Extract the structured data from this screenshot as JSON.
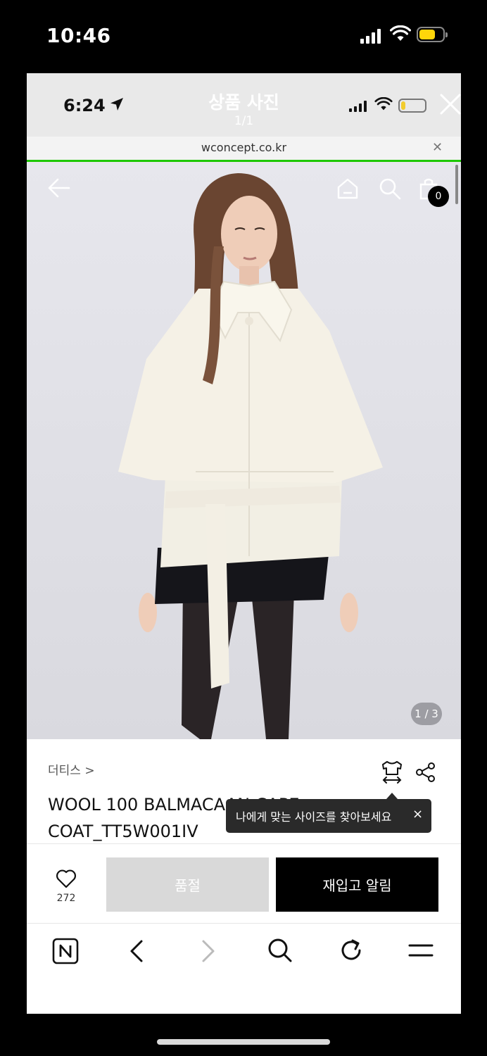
{
  "outer_status": {
    "time": "10:46"
  },
  "inner_status": {
    "time": "6:24"
  },
  "viewer": {
    "title": "상품 사진",
    "count": "1/1",
    "close_icon": "close-icon"
  },
  "browser": {
    "url": "wconcept.co.kr"
  },
  "nav": {
    "cart_count": "0"
  },
  "gallery": {
    "pager": "1 / 3"
  },
  "product": {
    "brand": "더티스 >",
    "title_line1": "WOOL 100 BALMACAAN CAPE",
    "title_line2": "COAT_TT5W001IV",
    "size_tooltip": "나에게 맞는 사이즈를 찾아보세요",
    "tooltip_close": "×"
  },
  "actions": {
    "like_count": "272",
    "soldout_label": "품절",
    "restock_label": "재입고 알림"
  },
  "colors": {
    "accent_green": "#1ec800",
    "battery_yellow": "#ffd60a",
    "primary_button": "#000000",
    "disabled_button": "#d9d9d9"
  }
}
